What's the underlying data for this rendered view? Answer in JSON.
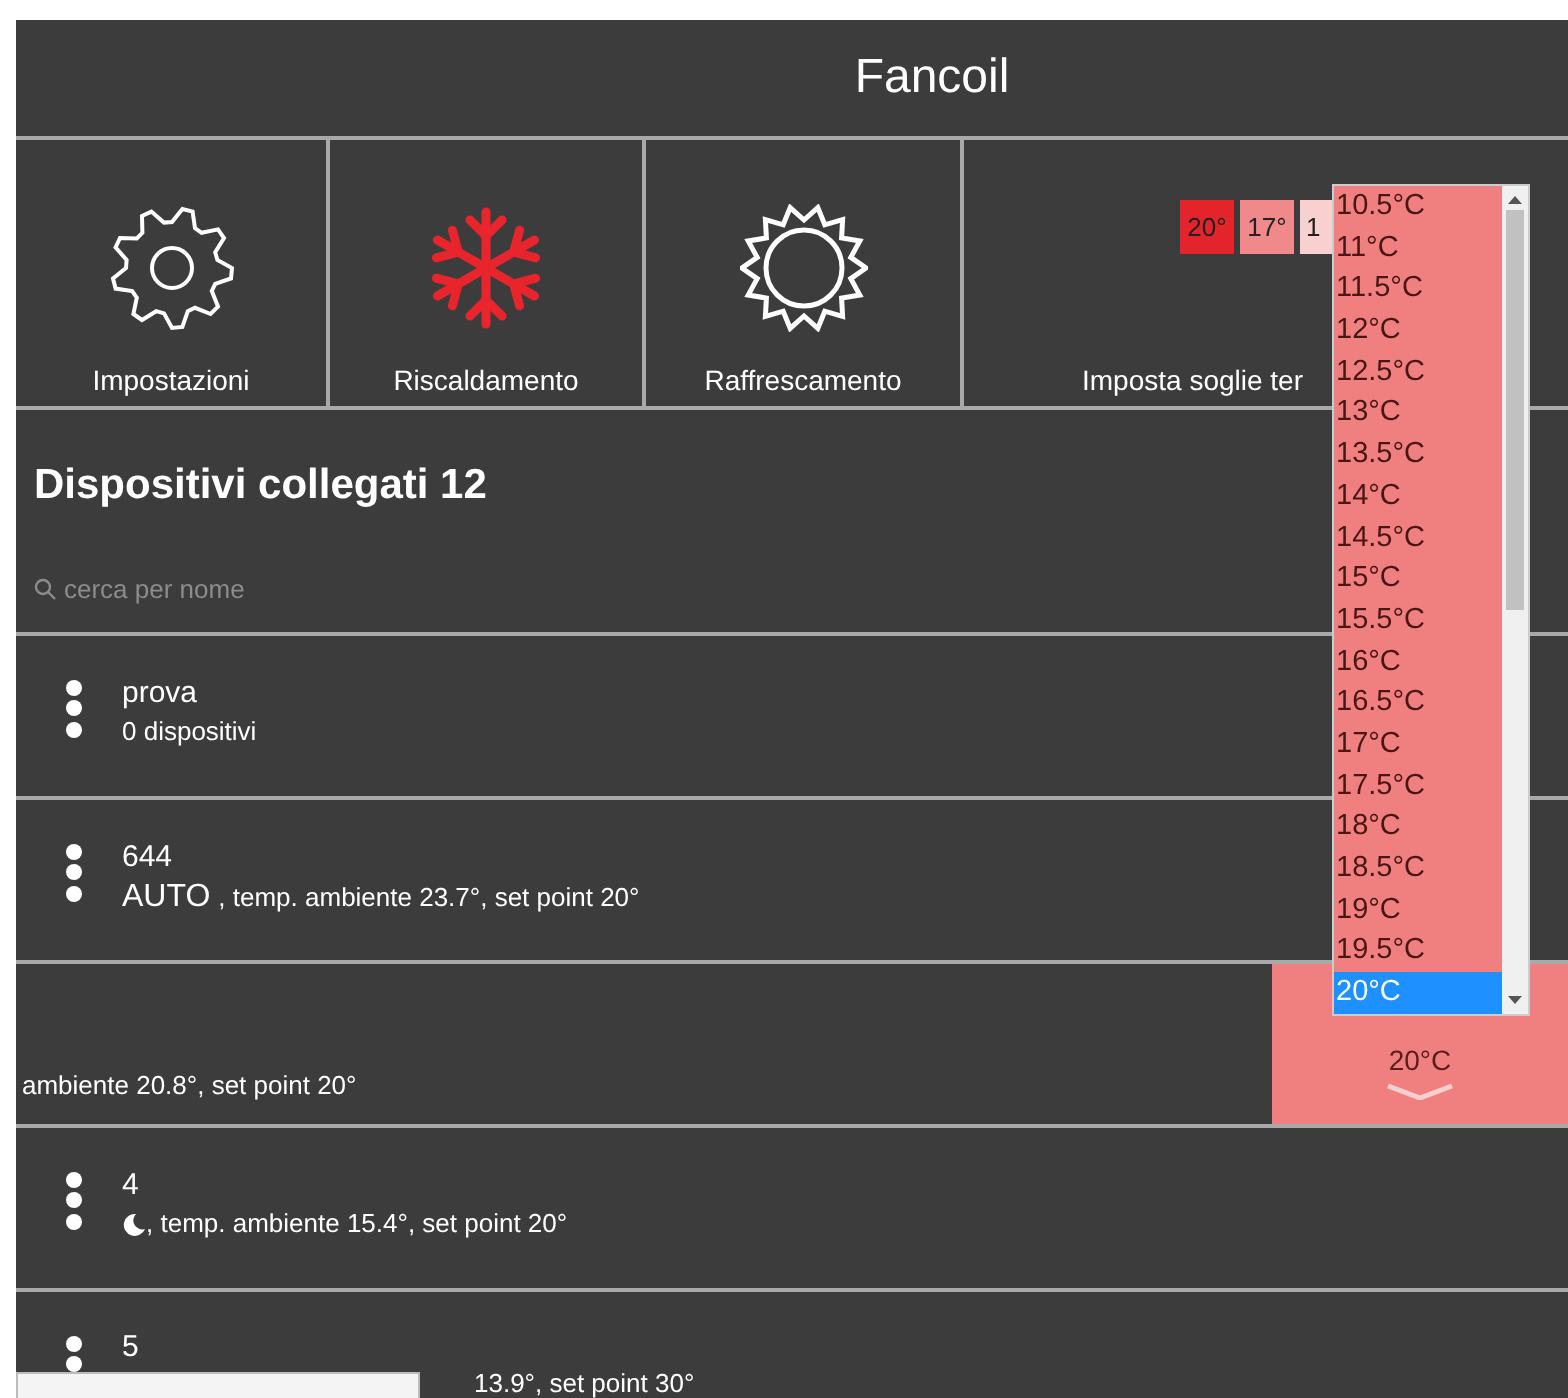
{
  "header": {
    "title": "Fancoil"
  },
  "tiles": [
    {
      "kind": "mode",
      "label": "Impostazioni",
      "active": false
    },
    {
      "kind": "mode",
      "label": "Riscaldamento",
      "active": true
    },
    {
      "kind": "mode",
      "label": "Raffrescamento",
      "active": false
    },
    {
      "kind": "thresholds",
      "label": "Imposta soglie ter",
      "chips": [
        {
          "text": "20°",
          "color": "#e3242b"
        },
        {
          "text": "17°",
          "color": "#f08a8a"
        },
        {
          "text": "1",
          "color": "#f8d0d0"
        }
      ]
    }
  ],
  "devices": {
    "title": "Dispositivi collegati 12",
    "search": {
      "placeholder": "cerca per nome"
    },
    "rows": [
      {
        "kind": "normal",
        "name": "prova",
        "detail": "0 dispositivi"
      },
      {
        "kind": "auto",
        "name": "644",
        "mode": "AUTO",
        "detail": ", temp. ambiente 23.7°, set point 20°"
      },
      {
        "kind": "swiped",
        "detail": "ambiente 20.8°, set point 20°",
        "setpoint": "20°C"
      },
      {
        "kind": "night",
        "name": "4",
        "detail": ", temp. ambiente 15.4°, set point 20°"
      },
      {
        "kind": "covered",
        "name": "5",
        "detail": "13.9°, set point 30°"
      }
    ]
  },
  "dropdown": {
    "options": [
      {
        "text": "10.5°C",
        "selected": false
      },
      {
        "text": "11°C",
        "selected": false
      },
      {
        "text": "11.5°C",
        "selected": false
      },
      {
        "text": "12°C",
        "selected": false
      },
      {
        "text": "12.5°C",
        "selected": false
      },
      {
        "text": "13°C",
        "selected": false
      },
      {
        "text": "13.5°C",
        "selected": false
      },
      {
        "text": "14°C",
        "selected": false
      },
      {
        "text": "14.5°C",
        "selected": false
      },
      {
        "text": "15°C",
        "selected": false
      },
      {
        "text": "15.5°C",
        "selected": false
      },
      {
        "text": "16°C",
        "selected": false
      },
      {
        "text": "16.5°C",
        "selected": false
      },
      {
        "text": "17°C",
        "selected": false
      },
      {
        "text": "17.5°C",
        "selected": false
      },
      {
        "text": "18°C",
        "selected": false
      },
      {
        "text": "18.5°C",
        "selected": false
      },
      {
        "text": "19°C",
        "selected": false
      },
      {
        "text": "19.5°C",
        "selected": false
      },
      {
        "text": "20°C",
        "selected": true
      }
    ]
  }
}
